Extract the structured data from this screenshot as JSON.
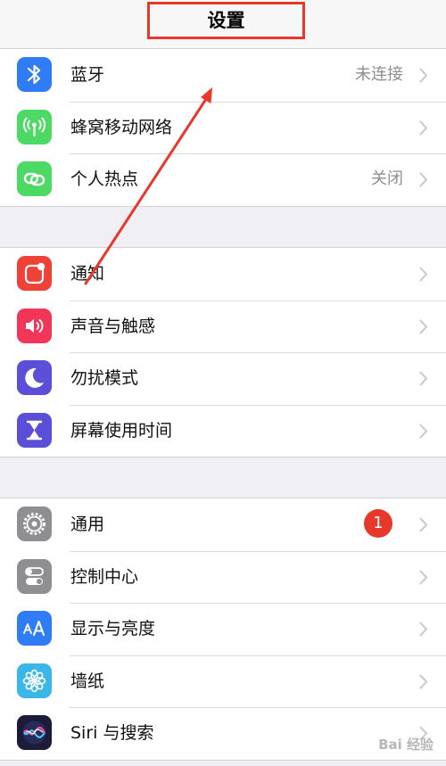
{
  "nav": {
    "title": "设置"
  },
  "groups": [
    {
      "items": [
        {
          "label": "蓝牙",
          "value": "未连接",
          "icon": "bluetooth-icon",
          "color": "#2f7cf6"
        },
        {
          "label": "蜂窝移动网络",
          "value": "",
          "icon": "cellular-icon",
          "color": "#4cd964"
        },
        {
          "label": "个人热点",
          "value": "关闭",
          "icon": "hotspot-icon",
          "color": "#4cd964"
        }
      ]
    },
    {
      "items": [
        {
          "label": "通知",
          "value": "",
          "icon": "notifications-icon",
          "color": "#f04137"
        },
        {
          "label": "声音与触感",
          "value": "",
          "icon": "sound-icon",
          "color": "#f2365a"
        },
        {
          "label": "勿扰模式",
          "value": "",
          "icon": "moon-icon",
          "color": "#5b4fd9"
        },
        {
          "label": "屏幕使用时间",
          "value": "",
          "icon": "hourglass-icon",
          "color": "#5b4fd9"
        }
      ]
    },
    {
      "items": [
        {
          "label": "通用",
          "value": "",
          "badge": "1",
          "icon": "gear-icon",
          "color": "#8e8e93"
        },
        {
          "label": "控制中心",
          "value": "",
          "icon": "toggles-icon",
          "color": "#8e8e93"
        },
        {
          "label": "显示与亮度",
          "value": "",
          "icon": "text-size-icon",
          "color": "#2f7cf6"
        },
        {
          "label": "墙纸",
          "value": "",
          "icon": "flower-icon",
          "color": "#3ab6e8"
        },
        {
          "label": "Siri 与搜索",
          "value": "",
          "icon": "siri-icon",
          "color": "#1c1c3a"
        }
      ]
    }
  ],
  "watermark": "Bai 经验",
  "colors": {
    "annotation": "#e8372b",
    "chevron": "#c7c7cc",
    "badge": "#e8372b"
  }
}
